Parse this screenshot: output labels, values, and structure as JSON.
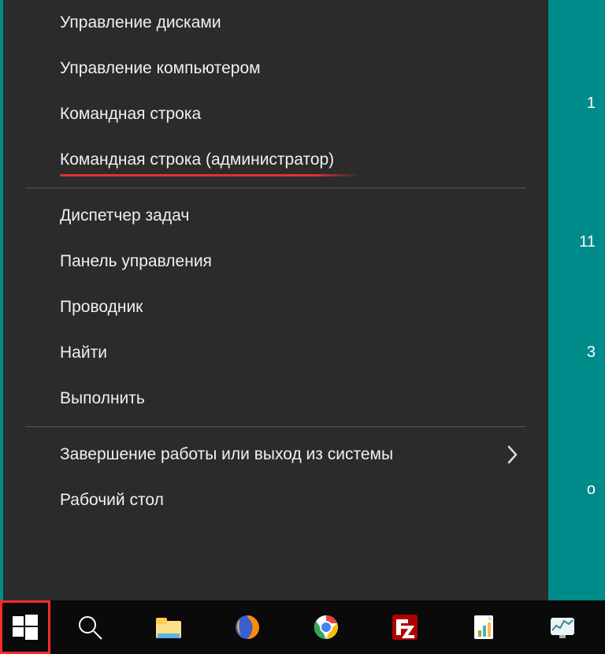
{
  "menu": {
    "group1": [
      "Управление дисками",
      "Управление компьютером",
      "Командная строка",
      "Командная строка (администратор)"
    ],
    "group2": [
      "Диспетчер задач",
      "Панель управления",
      "Проводник",
      "Найти",
      "Выполнить"
    ],
    "group3": [
      "Завершение работы или выход из системы",
      "Рабочий стол"
    ]
  },
  "desktop_hints": {
    "a": "1",
    "b": "11",
    "c": "3",
    "d": "о"
  },
  "highlighted_index": 3
}
